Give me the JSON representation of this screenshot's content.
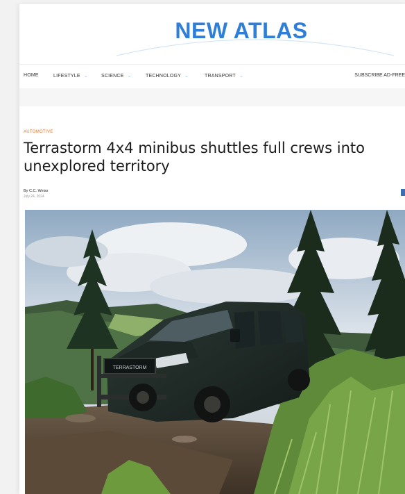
{
  "site": {
    "logo_text": "NEW ATLAS",
    "brand_color": "#2f7ed8"
  },
  "nav": {
    "items": [
      {
        "label": "HOME",
        "has_dropdown": false
      },
      {
        "label": "LIFESTYLE",
        "has_dropdown": true
      },
      {
        "label": "SCIENCE",
        "has_dropdown": true
      },
      {
        "label": "TECHNOLOGY",
        "has_dropdown": true
      },
      {
        "label": "TRANSPORT",
        "has_dropdown": true
      }
    ],
    "subscribe_label": "SUBSCRIBE AD-FREE"
  },
  "article": {
    "category": "AUTOMOTIVE",
    "category_color": "#e8742a",
    "title": "Terrastorm 4x4 minibus shuttles full crews into unexplored territory",
    "author": "By C.C. Weiss",
    "date": "July 24, 2024",
    "hero_image": {
      "icon": "hero-photo",
      "plate_text": "TERRASTORM"
    }
  }
}
